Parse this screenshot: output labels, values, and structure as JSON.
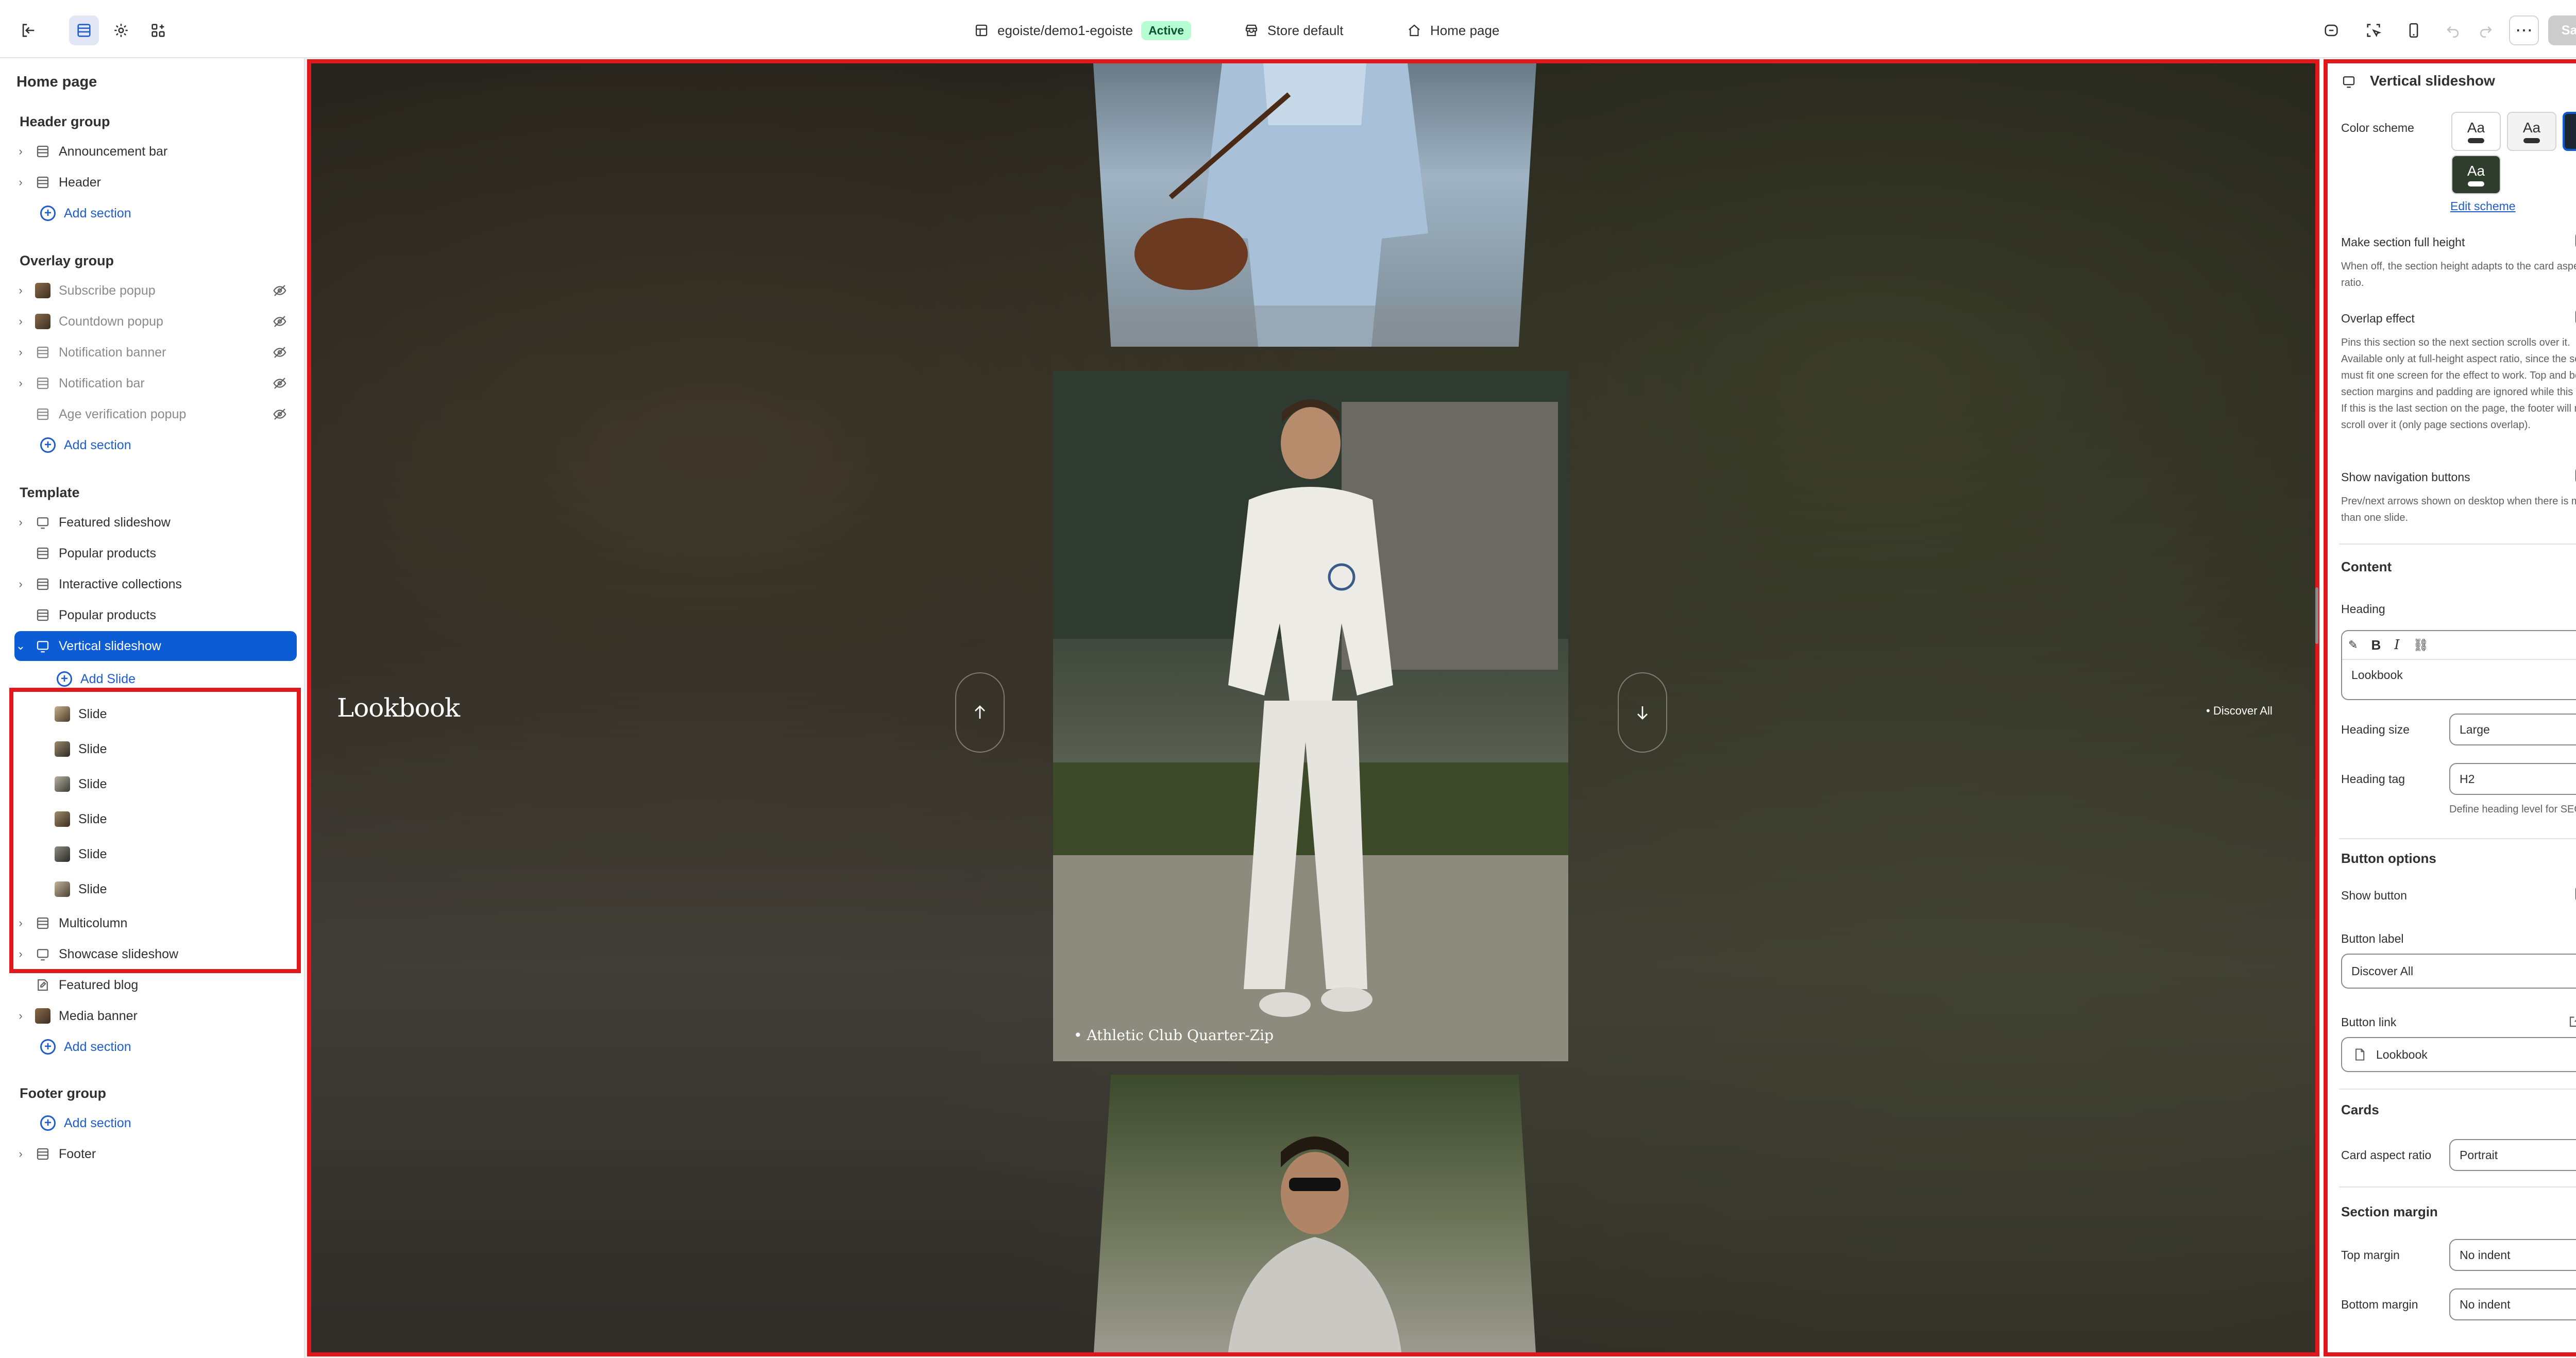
{
  "topbar": {
    "store_path": "egoiste/demo1-egoiste",
    "status_badge": "Active",
    "theme_label": "Store default",
    "page_label": "Home page",
    "save_label": "Save",
    "more_label": "⋯"
  },
  "sidebar": {
    "title": "Home page",
    "header_group": {
      "title": "Header group",
      "items": [
        {
          "label": "Announcement bar"
        },
        {
          "label": "Header"
        }
      ],
      "add_label": "Add section"
    },
    "overlay_group": {
      "title": "Overlay group",
      "items": [
        {
          "label": "Subscribe popup"
        },
        {
          "label": "Countdown popup"
        },
        {
          "label": "Notification banner"
        },
        {
          "label": "Notification bar"
        },
        {
          "label": "Age verification popup"
        }
      ],
      "add_label": "Add section"
    },
    "template": {
      "title": "Template",
      "items": [
        {
          "label": "Featured slideshow"
        },
        {
          "label": "Popular products"
        },
        {
          "label": "Interactive collections"
        },
        {
          "label": "Popular products"
        },
        {
          "label": "Vertical slideshow"
        }
      ],
      "add_slide_label": "Add Slide",
      "slides": [
        "Slide",
        "Slide",
        "Slide",
        "Slide",
        "Slide",
        "Slide"
      ],
      "after_items": [
        {
          "label": "Multicolumn"
        },
        {
          "label": "Showcase slideshow"
        },
        {
          "label": "Featured blog"
        },
        {
          "label": "Media banner"
        }
      ],
      "add_label": "Add section"
    },
    "footer_group": {
      "title": "Footer group",
      "add_label": "Add section",
      "items": [
        {
          "label": "Footer"
        }
      ]
    }
  },
  "preview": {
    "heading": "Lookbook",
    "button_label": "Discover All",
    "card_caption": "Athletic Club Quarter-Zip"
  },
  "settings": {
    "title": "Vertical slideshow",
    "color_scheme_label": "Color scheme",
    "scheme_sample": "Aa",
    "edit_scheme_label": "Edit scheme",
    "full_height_label": "Make section full height",
    "full_height_help": "When off, the section height adapts to the card aspect ratio.",
    "overlap_label": "Overlap effect",
    "overlap_help": "Pins this section so the next section scrolls over it. Available only at full-height aspect ratio, since the section must fit one screen for the effect to work. Top and bottom section margins and padding are ignored while this is on. If this is the last section on the page, the footer will not scroll over it (only page sections overlap).",
    "nav_buttons_label": "Show navigation buttons",
    "nav_buttons_help": "Prev/next arrows shown on desktop when there is more than one slide.",
    "content_section": "Content",
    "heading_label": "Heading",
    "heading_value": "Lookbook",
    "heading_size_label": "Heading size",
    "heading_size_value": "Large",
    "heading_tag_label": "Heading tag",
    "heading_tag_value": "H2",
    "heading_tag_help": "Define heading level for SEO.",
    "button_options_section": "Button options",
    "show_button_label": "Show button",
    "button_label_label": "Button label",
    "button_label_value": "Discover All",
    "button_link_label": "Button link",
    "button_link_value": "Lookbook",
    "cards_section": "Cards",
    "card_ratio_label": "Card aspect ratio",
    "card_ratio_value": "Portrait",
    "margin_section": "Section margin",
    "top_margin_label": "Top margin",
    "top_margin_value": "No indent",
    "bottom_margin_label": "Bottom margin",
    "bottom_margin_value": "No indent"
  },
  "colors": {
    "accent": "#0b5cd5",
    "highlight": "#e0181b",
    "active_badge_bg": "#b4fed2"
  }
}
